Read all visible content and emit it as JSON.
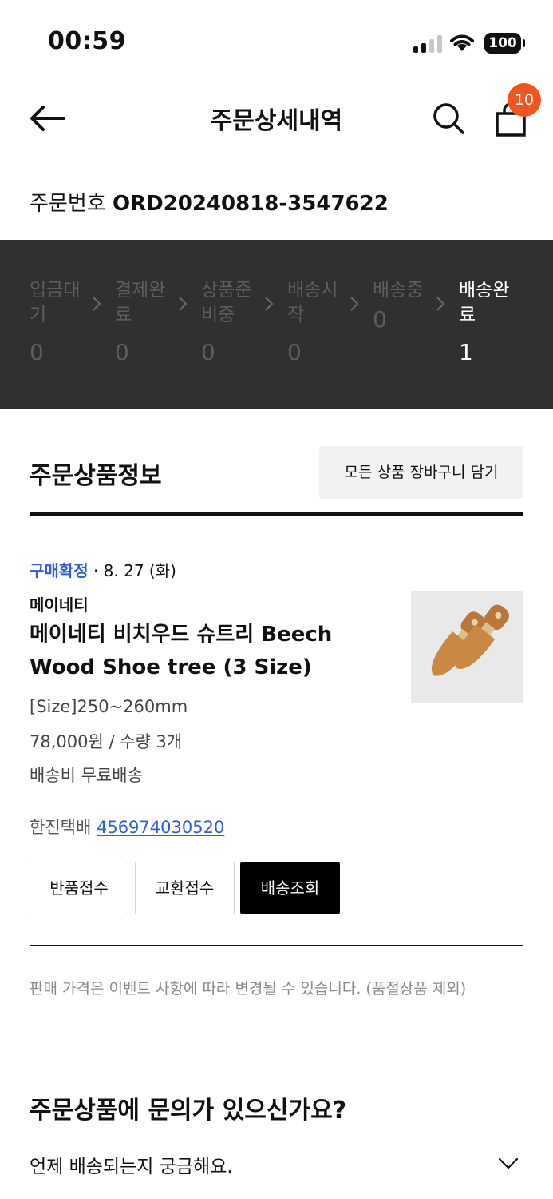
{
  "status_bar": {
    "time": "00:59",
    "battery": "100"
  },
  "header": {
    "title": "주문상세내역",
    "cart_count": "10",
    "icons": {
      "back": "arrow-left",
      "search": "magnifier",
      "bag": "shopping-bag"
    }
  },
  "order": {
    "number_label": "주문번호",
    "number_value": "ORD20240818-3547622"
  },
  "progress": {
    "steps": [
      {
        "label": "입금대기",
        "count": "0"
      },
      {
        "label": "결제완료",
        "count": "0"
      },
      {
        "label": "상품준비중",
        "count": "0"
      },
      {
        "label": "배송시작",
        "count": "0"
      },
      {
        "label": "배송중",
        "count": "0"
      },
      {
        "label": "배송완료",
        "count": "1"
      }
    ],
    "active_index": 5
  },
  "product_section": {
    "title": "주문상품정보",
    "cart_all_label": "모든 상품 장바구니 담기"
  },
  "item": {
    "status": "구매확정",
    "date": " · 8. 27 (화)",
    "brand": "메이네티",
    "name": "메이네티 비치우드 슈트리 Beech Wood Shoe tree (3 Size)",
    "option": "[Size]250~260mm",
    "price_qty": "78,000원 / 수량 3개",
    "shipping": "배송비 무료배송",
    "carrier": "한진택배",
    "tracking_number": "456974030520",
    "actions": {
      "return": "반품접수",
      "exchange": "교환접수",
      "track": "배송조회"
    }
  },
  "notice": "판매 가격은 이벤트 사항에 따라 변경될 수 있습니다. (품절상품 제외)",
  "inquiry": {
    "title": "주문상품에 문의가 있으신가요?",
    "faq": "언제 배송되는지 궁금해요."
  },
  "colors": {
    "accent_blue": "#2f5fd8",
    "badge_orange": "#f0551f",
    "panel_dark": "#303030"
  }
}
